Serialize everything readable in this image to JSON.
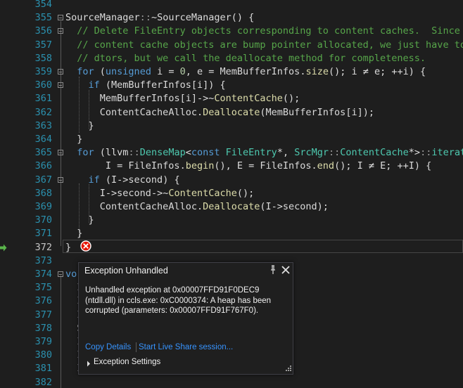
{
  "editor": {
    "current_line": "372",
    "lines": [
      {
        "n": "354",
        "tokens": []
      },
      {
        "n": "355",
        "tokens": [
          [
            "",
            "SourceManager"
          ],
          [
            "pm",
            "::"
          ],
          [
            "",
            "~SourceManager"
          ],
          [
            "",
            "() {"
          ]
        ]
      },
      {
        "n": "356",
        "tokens": [
          [
            "",
            "  "
          ],
          [
            "cm",
            "// Delete FileEntry objects corresponding to content caches.  Since the actual"
          ]
        ]
      },
      {
        "n": "357",
        "tokens": [
          [
            "",
            "  "
          ],
          [
            "cm",
            "// content cache objects are bump pointer allocated, we just have to run the"
          ]
        ]
      },
      {
        "n": "358",
        "tokens": [
          [
            "",
            "  "
          ],
          [
            "cm",
            "// dtors, but we call the deallocate method for completeness."
          ]
        ]
      },
      {
        "n": "359",
        "tokens": [
          [
            "",
            "  "
          ],
          [
            "kw",
            "for"
          ],
          [
            "",
            " ("
          ],
          [
            "kw",
            "unsigned"
          ],
          [
            "",
            " i = "
          ],
          [
            "nm",
            "0"
          ],
          [
            "",
            ", e = "
          ],
          [
            "mb",
            "MemBufferInfos"
          ],
          [
            "",
            "."
          ],
          [
            "fn",
            "size"
          ],
          [
            "",
            "(); i ≠ e; ++i) {"
          ]
        ]
      },
      {
        "n": "360",
        "tokens": [
          [
            "",
            "    "
          ],
          [
            "kw",
            "if"
          ],
          [
            "",
            " ("
          ],
          [
            "mb",
            "MemBufferInfos"
          ],
          [
            "",
            "[i]) {"
          ]
        ]
      },
      {
        "n": "361",
        "tokens": [
          [
            "",
            "      "
          ],
          [
            "mb",
            "MemBufferInfos"
          ],
          [
            "",
            "[i]->~"
          ],
          [
            "fn",
            "ContentCache"
          ],
          [
            "",
            "();"
          ]
        ]
      },
      {
        "n": "362",
        "tokens": [
          [
            "",
            "      "
          ],
          [
            "mb",
            "ContentCacheAlloc"
          ],
          [
            "",
            "."
          ],
          [
            "fn",
            "Deallocate"
          ],
          [
            "",
            "("
          ],
          [
            "mb",
            "MemBufferInfos"
          ],
          [
            "",
            "[i]);"
          ]
        ]
      },
      {
        "n": "363",
        "tokens": [
          [
            "",
            "    }"
          ]
        ]
      },
      {
        "n": "364",
        "tokens": [
          [
            "",
            "  }"
          ]
        ]
      },
      {
        "n": "365",
        "tokens": [
          [
            "",
            "  "
          ],
          [
            "kw",
            "for"
          ],
          [
            "",
            " (llvm"
          ],
          [
            "pm",
            "::"
          ],
          [
            "ty",
            "DenseMap"
          ],
          [
            "",
            "<"
          ],
          [
            "kw",
            "const"
          ],
          [
            "",
            " "
          ],
          [
            "ty",
            "FileEntry"
          ],
          [
            "",
            "*, "
          ],
          [
            "ty",
            "SrcMgr"
          ],
          [
            "pm",
            "::"
          ],
          [
            "ty",
            "ContentCache"
          ],
          [
            "",
            "*>"
          ],
          [
            "pm",
            "::"
          ],
          [
            "ty",
            "iterator"
          ]
        ]
      },
      {
        "n": "366",
        "tokens": [
          [
            "",
            "       I = "
          ],
          [
            "mb",
            "FileInfos"
          ],
          [
            "",
            "."
          ],
          [
            "fn",
            "begin"
          ],
          [
            "",
            "(), E = "
          ],
          [
            "mb",
            "FileInfos"
          ],
          [
            "",
            "."
          ],
          [
            "fn",
            "end"
          ],
          [
            "",
            "(); I ≠ E; ++I) {"
          ]
        ]
      },
      {
        "n": "367",
        "tokens": [
          [
            "",
            "    "
          ],
          [
            "kw",
            "if"
          ],
          [
            "",
            " (I->"
          ],
          [
            "mb",
            "second"
          ],
          [
            "",
            ") {"
          ]
        ]
      },
      {
        "n": "368",
        "tokens": [
          [
            "",
            "      I->"
          ],
          [
            "mb",
            "second"
          ],
          [
            "",
            "->~"
          ],
          [
            "fn",
            "ContentCache"
          ],
          [
            "",
            "();"
          ]
        ]
      },
      {
        "n": "369",
        "tokens": [
          [
            "",
            "      "
          ],
          [
            "mb",
            "ContentCacheAlloc"
          ],
          [
            "",
            "."
          ],
          [
            "fn",
            "Deallocate"
          ],
          [
            "",
            "(I->"
          ],
          [
            "mb",
            "second"
          ],
          [
            "",
            ");"
          ]
        ]
      },
      {
        "n": "370",
        "tokens": [
          [
            "",
            "    }"
          ]
        ]
      },
      {
        "n": "371",
        "tokens": [
          [
            "",
            "  }"
          ]
        ]
      },
      {
        "n": "372",
        "tokens": [
          [
            "",
            "}"
          ]
        ]
      },
      {
        "n": "373",
        "tokens": []
      },
      {
        "n": "374",
        "tokens": [
          [
            "kw",
            "vo"
          ]
        ]
      },
      {
        "n": "375",
        "tokens": [
          [
            "",
            "  I"
          ]
        ]
      },
      {
        "n": "376",
        "tokens": [
          [
            "",
            "  I"
          ]
        ]
      },
      {
        "n": "377",
        "tokens": [
          [
            "",
            "  I"
          ]
        ]
      },
      {
        "n": "378",
        "tokens": [
          [
            "",
            "  S"
          ]
        ]
      },
      {
        "n": "379",
        "tokens": [
          [
            "",
            "  I"
          ]
        ]
      },
      {
        "n": "380",
        "tokens": [
          [
            "",
            "  I"
          ]
        ]
      },
      {
        "n": "381",
        "tokens": [
          [
            "",
            "  I"
          ]
        ]
      },
      {
        "n": "382",
        "tokens": []
      }
    ]
  },
  "exception_popup": {
    "title": "Exception Unhandled",
    "message": "Unhandled exception at 0x00007FFD91F0DEC9 (ntdll.dll) in ccls.exe: 0xC0000374: A heap has been corrupted (parameters: 0x00007FFD91F767F0).",
    "copy_details_label": "Copy Details",
    "live_share_label": "Start Live Share session...",
    "exception_settings_label": "Exception Settings"
  },
  "colors": {
    "background": "#1e1e1e",
    "line_number": "#2b91af",
    "keyword": "#569cd6",
    "type": "#4ec9b0",
    "comment": "#57a64a",
    "function": "#dcdcaa",
    "number": "#b5cea8",
    "error_red": "#e51400",
    "link": "#3794ff",
    "execution_arrow": "#5ab54b"
  },
  "icons": [
    "error-icon",
    "pin-icon",
    "close-icon",
    "execution-arrow-icon",
    "expand-arrow-icon",
    "resize-grip-icon",
    "fold-toggle-icon"
  ]
}
